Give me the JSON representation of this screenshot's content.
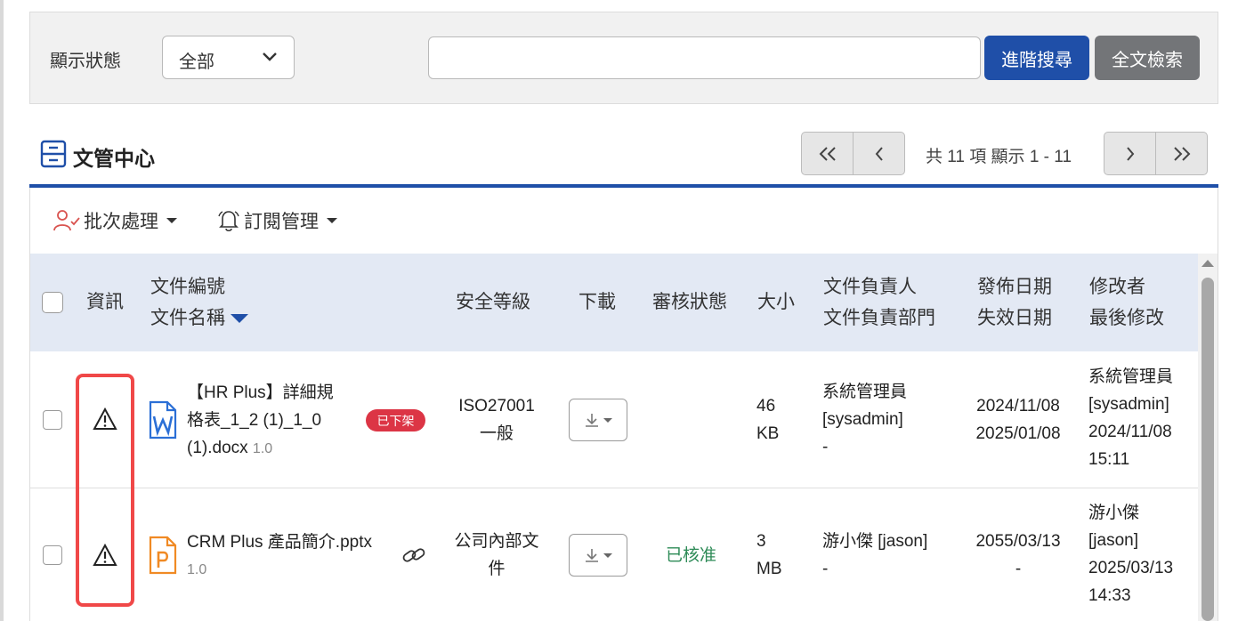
{
  "filter": {
    "label": "顯示狀態",
    "status_value": "全部",
    "search_value": "",
    "advanced_search": "進階搜尋",
    "full_text_search": "全文檢索"
  },
  "title": "文管中心",
  "pager": {
    "info": "共 11 項 顯示 1 - 11"
  },
  "toolbar": {
    "batch": "批次處理",
    "subscribe": "訂閱管理"
  },
  "columns": {
    "info": "資訊",
    "doc_no": "文件編號",
    "doc_name": "文件名稱",
    "security": "安全等級",
    "download": "下載",
    "review": "審核狀態",
    "size": "大小",
    "owner": "文件負責人",
    "owner_dept": "文件負責部門",
    "publish": "發佈日期",
    "expire": "失效日期",
    "modifier": "修改者",
    "last_modified": "最後修改"
  },
  "rows": [
    {
      "name_l1": "【HR Plus】詳細規",
      "name_l2": "格表_1_2 (1)_1_0",
      "name_l3": "(1).docx",
      "version": "1.0",
      "file_type": "word-file-icon",
      "badge": "已下架",
      "security_l1": "ISO27001",
      "security_l2": "一般",
      "review": "",
      "size_l1": "46",
      "size_l2": "KB",
      "owner_l1": "系統管理員",
      "owner_l2": "[sysadmin]",
      "owner_l3": "-",
      "publish": "2024/11/08",
      "expire": "2025/01/08",
      "mod_l1": "系統管理員",
      "mod_l2": "[sysadmin]",
      "mod_l3": "2024/11/08",
      "mod_l4": "15:11"
    },
    {
      "name_l1": "CRM Plus 產品簡介.pptx",
      "version": "1.0",
      "file_type": "powerpoint-file-icon",
      "security_l1": "公司內部文",
      "security_l2": "件",
      "review": "已核准",
      "size_l1": "3",
      "size_l2": "MB",
      "owner_l1": "游小傑 [jason]",
      "owner_l2": "-",
      "publish": "2055/03/13",
      "expire": "-",
      "mod_l1": "游小傑",
      "mod_l2": "[jason]",
      "mod_l3": "2025/03/13",
      "mod_l4": "14:33"
    }
  ],
  "colors": {
    "primary": "#1f4fa8",
    "secondary_button": "#737578",
    "header_bg": "#e3e9f4",
    "badge_red": "#dc3545",
    "approved_green": "#2e8b57",
    "highlight": "#f04848"
  }
}
